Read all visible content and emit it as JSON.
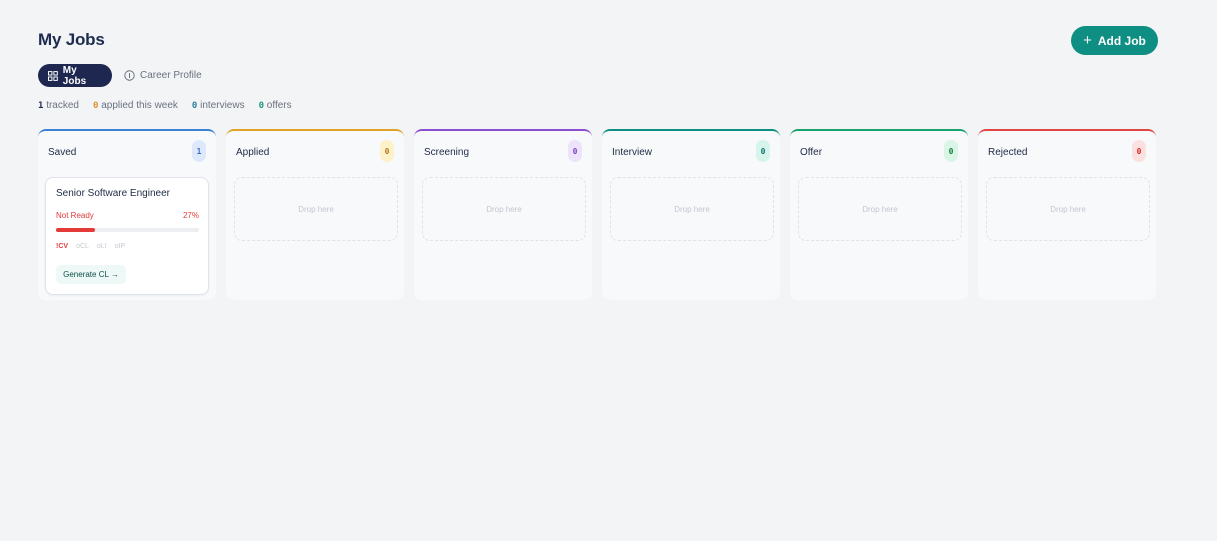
{
  "header": {
    "title": "My Jobs",
    "add_label": "Add Job"
  },
  "tabs": [
    {
      "label": "My Jobs",
      "icon": "grid-icon",
      "active": true
    },
    {
      "label": "Career Profile",
      "icon": "info-circle-icon",
      "active": false
    }
  ],
  "stats": {
    "tracked_count": "1",
    "tracked_label": "tracked",
    "applied_count": "0",
    "applied_label": "applied this week",
    "interviews_count": "0",
    "interviews_label": "interviews",
    "offers_count": "0",
    "offers_label": "offers"
  },
  "columns": [
    {
      "title": "Saved",
      "count": "1",
      "accent": "#3b82d6",
      "badge_bg": "#dde9fb",
      "badge_fg": "#3b6fcf"
    },
    {
      "title": "Applied",
      "count": "0",
      "accent": "#e0a326",
      "badge_bg": "#fdf1c9",
      "badge_fg": "#b7791f"
    },
    {
      "title": "Screening",
      "count": "0",
      "accent": "#8b4fd3",
      "badge_bg": "#ede3fb",
      "badge_fg": "#7a45c5"
    },
    {
      "title": "Interview",
      "count": "0",
      "accent": "#0f8f83",
      "badge_bg": "#d6f3ec",
      "badge_fg": "#0f766e"
    },
    {
      "title": "Offer",
      "count": "0",
      "accent": "#19a36c",
      "badge_bg": "#d9f5e6",
      "badge_fg": "#15803d"
    },
    {
      "title": "Rejected",
      "count": "0",
      "accent": "#e04646",
      "badge_bg": "#fbe0e0",
      "badge_fg": "#dc2626"
    }
  ],
  "drop_label": "Drop here",
  "card": {
    "title": "Senior Software Engineer",
    "status": "Not Ready",
    "percent_label": "27%",
    "progress": 0.27,
    "docs": [
      "!CV",
      "oCL",
      "oLI",
      "oIP"
    ],
    "action_label": "Generate CL →"
  }
}
